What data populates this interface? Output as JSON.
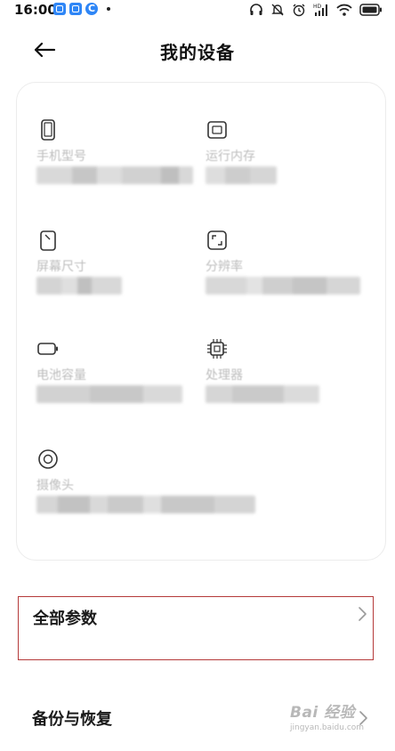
{
  "status_bar": {
    "time": "16:00"
  },
  "header": {
    "title": "我的设备"
  },
  "specs": [
    {
      "label": "手机型号",
      "icon": "phone-icon"
    },
    {
      "label": "运行内存",
      "icon": "memory-chip-icon"
    },
    {
      "label": "屏幕尺寸",
      "icon": "screen-size-icon"
    },
    {
      "label": "分辨率",
      "icon": "resolution-icon"
    },
    {
      "label": "电池容量",
      "icon": "battery-icon"
    },
    {
      "label": "处理器",
      "icon": "processor-icon"
    },
    {
      "label": "摄像头",
      "icon": "camera-icon"
    }
  ],
  "rows": {
    "all_params": "全部参数",
    "backup_restore": "备份与恢复"
  },
  "watermark": {
    "logo": "Bai 经验",
    "url": "jingyan.baidu.com"
  },
  "colors": {
    "accent_notification": "#2f86f6",
    "highlight_border": "#b53a3a",
    "label_gray": "#bdbdbd"
  }
}
